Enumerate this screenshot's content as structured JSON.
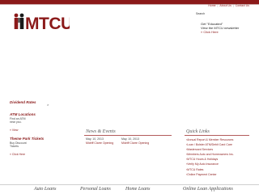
{
  "header": {
    "links": [
      "Home",
      "About Us",
      "Contact Us"
    ],
    "search_label": "Search",
    "logo_text": "MTCU",
    "brand_color": "#8b1a1a",
    "brand_color_dark": "#1a1a1a"
  },
  "ad": {
    "lines": [
      "Get \"Educated\"",
      "View the MTCU newsletter",
      "» Click Here"
    ]
  },
  "banner": {
    "caption": "Dividend Rates",
    "caret": ">"
  },
  "sidebar": {
    "atm_title": "ATM Locations",
    "atm_text_1": "Find an ATM",
    "atm_text_2": "near you.",
    "atm_link": "» View",
    "parks_title": "Theme Park Tickets",
    "parks_text_1": "Buy Discount",
    "parks_text_2": "Tickets",
    "parks_link": "» Click Here"
  },
  "news": {
    "title": "News & Events",
    "items": [
      {
        "date": "May. 10, 2013",
        "text": "Midriff Clarre Opening"
      },
      {
        "date": "May. 10, 2013",
        "text": "Midriff Clarre Opening"
      }
    ]
  },
  "quick_links": {
    "title": "Quick Links",
    "items": [
      "Annual Report & Member Resources",
      "Loan / Bolster ATM/Debit Card Care",
      "Mastercard Services",
      "Members Auto and Homeowners Ins.",
      "MTCU Hours & Holidays",
      "Verify My Auto Insurance",
      "MTCU Rates",
      "Online Payment Center"
    ]
  },
  "footer": {
    "items": [
      "Auto Loans",
      "Personal Loans",
      "Home Loans",
      "Online Loan Applications"
    ]
  }
}
